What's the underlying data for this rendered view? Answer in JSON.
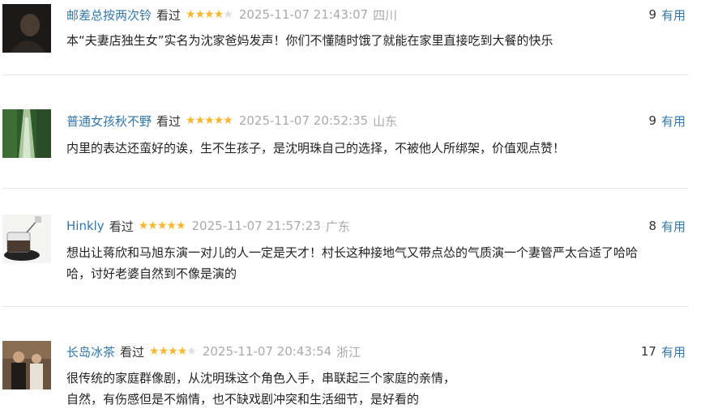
{
  "comments": [
    {
      "user": "邮差总按两次铃",
      "status": "看过",
      "rating": 4,
      "time": "2025-11-07 21:43:07",
      "region": "四川",
      "votes": "9",
      "vote_label": "有用",
      "lines": [
        "本“夫妻店独生女”实名为沈家爸妈发声！你们不懂随时饿了就能在家里直接吃到大餐的快乐"
      ]
    },
    {
      "user": "普通女孩秋不野",
      "status": "看过",
      "rating": 5,
      "time": "2025-11-07 20:52:35",
      "region": "山东",
      "votes": "9",
      "vote_label": "有用",
      "lines": [
        "内里的表达还蛮好的诶，生不生孩子，是沈明珠自己的选择，不被他人所绑架，价值观点赞！"
      ]
    },
    {
      "user": "Hinkly",
      "status": "看过",
      "rating": 5,
      "time": "2025-11-07 21:57:23",
      "region": "广东",
      "votes": "8",
      "vote_label": "有用",
      "lines": [
        "想出让蒋欣和马旭东演一对儿的人一定是天才！村长这种接地气又带点怂的气质演一个妻管严太合适了哈哈",
        "哈，讨好老婆自然到不像是演的"
      ]
    },
    {
      "user": "长岛冰茶",
      "status": "看过",
      "rating": 4,
      "time": "2025-11-07 20:43:54",
      "region": "浙江",
      "votes": "17",
      "vote_label": "有用",
      "lines": [
        "很传统的家庭群像剧，从沈明珠这个角色入手，串联起三个家庭的亲情，",
        "自然，有伤感但是不煽情，也不缺戏剧冲突和生活细节，是好看的"
      ]
    }
  ],
  "star_color": "#f7b733",
  "user_color": "#3377aa"
}
